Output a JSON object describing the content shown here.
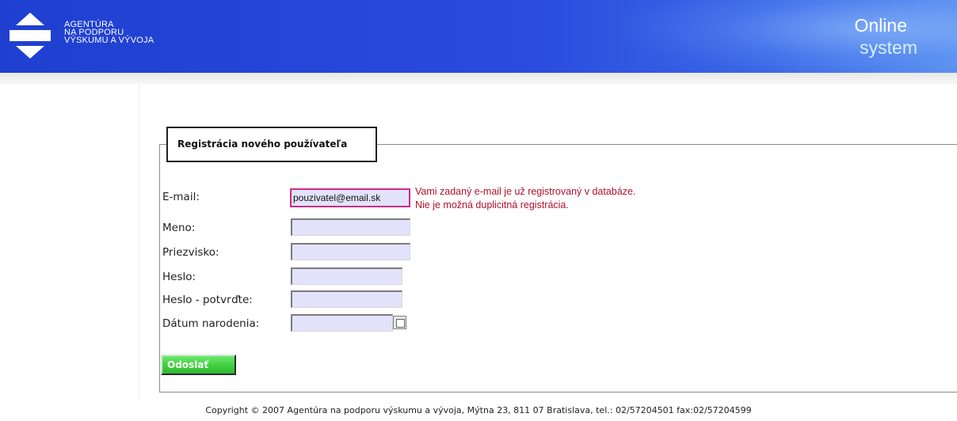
{
  "header": {
    "agency_lines": [
      "AGENTÚRA",
      "NA PODPORU",
      "VÝSKUMU A VÝVOJA"
    ],
    "online": "Online",
    "system": "system",
    "logo_icon": "double-arrow-logo-icon",
    "colors": {
      "header_blue": "#1f3fd0",
      "header_light": "#5b90ef"
    }
  },
  "form": {
    "legend": "Registrácia nového používateľa",
    "fields": {
      "email": {
        "label": "E-mail:",
        "value": "pouzivatel@email.sk"
      },
      "meno": {
        "label": "Meno:",
        "value": ""
      },
      "priezvisko": {
        "label": "Priezvisko:",
        "value": ""
      },
      "heslo": {
        "label": "Heslo:",
        "value": ""
      },
      "heslo_confirm": {
        "label": "Heslo - potvrďte:",
        "value": ""
      },
      "datum": {
        "label": "Dátum narodenia:",
        "value": ""
      }
    },
    "error_lines": [
      "Vami zadaný e-mail je už registrovaný v databáze.",
      "Nie je možná duplicitná registrácia."
    ],
    "submit": "Odoslať",
    "calendar_icon": "calendar-icon",
    "colors": {
      "error": "#b0102c",
      "error_border": "#d02c86",
      "input_bg": "#e2e3fb",
      "submit_green": "#3fcf3f"
    }
  },
  "footer": {
    "copyright": "Copyright © 2007 Agentúra na podporu výskumu a vývoja, Mýtna 23, 811 07 Bratislava, tel.: 02/57204501 fax:02/57204599"
  }
}
